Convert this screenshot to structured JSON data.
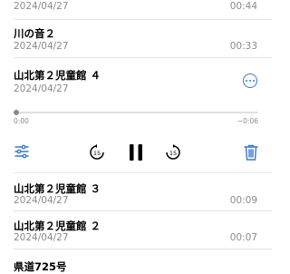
{
  "recordings": [
    {
      "title": "",
      "date": "2024/04/27",
      "duration": "00:44"
    },
    {
      "title": "川の音２",
      "date": "2024/04/27",
      "duration": "00:33"
    },
    {
      "title": "山北第２児童館 ４",
      "date": "2024/04/27",
      "duration": ""
    },
    {
      "title": "山北第２児童館 ３",
      "date": "2024/04/27",
      "duration": "00:09"
    },
    {
      "title": "山北第２児童館 ２",
      "date": "2024/04/27",
      "duration": "00:07"
    },
    {
      "title": "県道725号",
      "date": "",
      "duration": ""
    }
  ],
  "player": {
    "elapsed": "0:00",
    "remaining": "−0:06",
    "progress_fraction": 0.0,
    "skip_back_seconds": "15",
    "skip_forward_seconds": "15"
  },
  "colors": {
    "accent": "#3a79c9",
    "secondary_text": "#8a8a8e"
  },
  "icons": [
    "more-options-icon",
    "settings-sliders-icon",
    "skip-back-15-icon",
    "pause-icon",
    "skip-forward-15-icon",
    "trash-icon"
  ]
}
